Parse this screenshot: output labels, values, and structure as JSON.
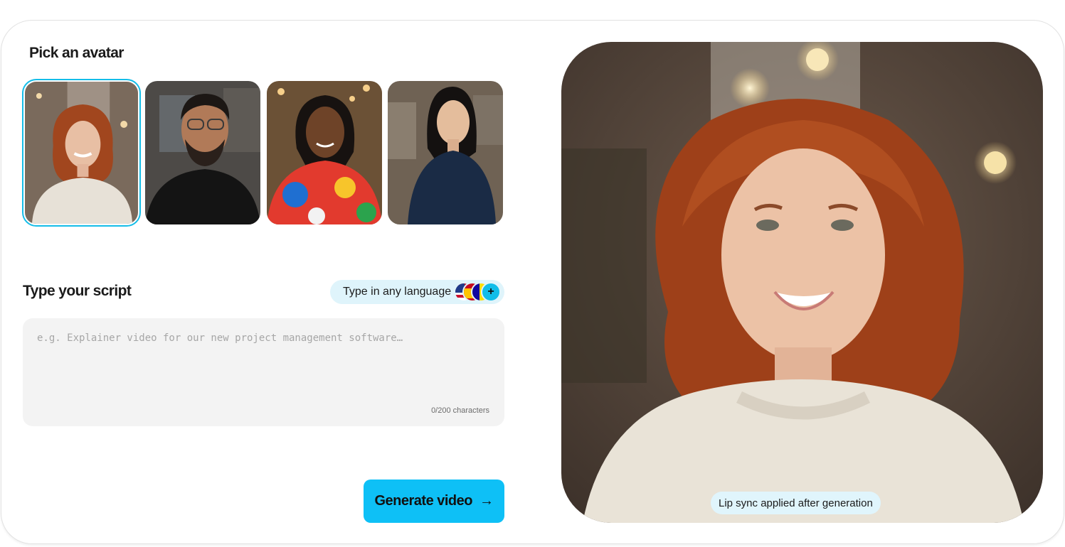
{
  "avatar_section": {
    "title": "Pick an avatar",
    "avatars": [
      {
        "name": "avatar-red-curly-hair",
        "selected": true
      },
      {
        "name": "avatar-man-glasses",
        "selected": false
      },
      {
        "name": "avatar-woman-colorful-shirt",
        "selected": false
      },
      {
        "name": "avatar-woman-navy-shirt",
        "selected": false
      }
    ]
  },
  "script_section": {
    "title": "Type your script",
    "language_pill": "Type in any language",
    "more_languages_label": "+",
    "placeholder": "e.g. Explainer video for our new project management software…",
    "value": "",
    "char_count": "0/200 characters"
  },
  "generate_button": {
    "label": "Generate video",
    "arrow": "→"
  },
  "preview": {
    "badge": "Lip sync applied after generation"
  },
  "colors": {
    "accent": "#0ec0f6",
    "pill_bg": "#dff4fb",
    "selected_border": "#14bde8"
  },
  "icons": [
    "us-flag-icon",
    "spain-flag-icon",
    "andorra-flag-icon",
    "plus-icon",
    "arrow-right-icon"
  ]
}
